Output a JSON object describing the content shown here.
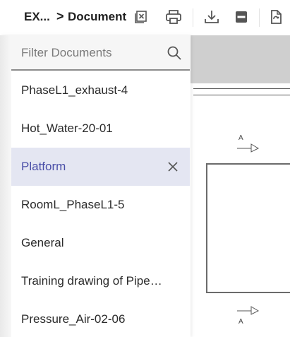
{
  "header": {
    "breadcrumb_root": "EX...",
    "breadcrumb_separator": ">",
    "breadcrumb_current": "Document",
    "tools": [
      {
        "icon": "close-document-icon"
      },
      {
        "icon": "print-icon"
      },
      {
        "icon": "download-icon"
      },
      {
        "icon": "pdf-icon"
      },
      {
        "icon": "export-document-icon"
      }
    ]
  },
  "filter": {
    "placeholder": "Filter Documents",
    "value": "",
    "icon": "search-icon"
  },
  "documents": [
    {
      "label": "PhaseL1_exhaust-4",
      "selected": false
    },
    {
      "label": "Hot_Water-20-01",
      "selected": false
    },
    {
      "label": "Platform",
      "selected": true
    },
    {
      "label": "RoomL_PhaseL1-5",
      "selected": false
    },
    {
      "label": "General",
      "selected": false
    },
    {
      "label": "Training drawing of Pipe…",
      "selected": false
    },
    {
      "label": "Pressure_Air-02-06",
      "selected": false
    }
  ],
  "viewer": {
    "section_label_top": "A",
    "section_label_bottom": "A"
  },
  "colors": {
    "selected_bg": "#e4e6f2",
    "selected_text": "#4a4fa8",
    "band": "#cfcfcf"
  }
}
